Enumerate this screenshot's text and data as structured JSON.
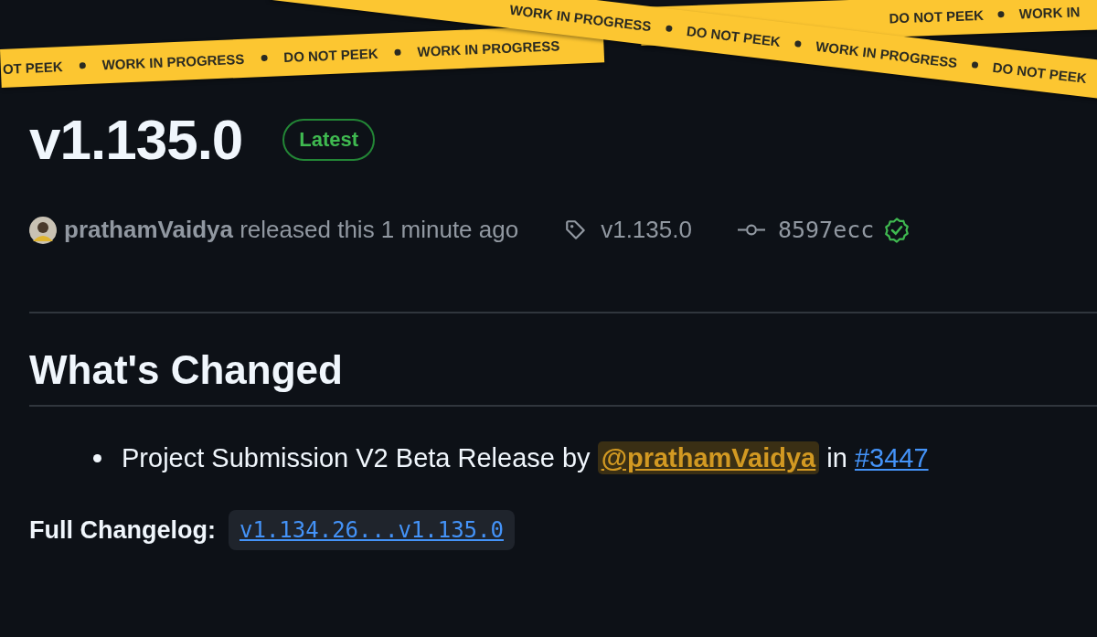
{
  "tapes": [
    {
      "texts": [
        "DO NOT PEEK",
        "WORK IN"
      ]
    },
    {
      "texts": [
        "OT PEEK",
        "WORK IN PROGRESS",
        "DO NOT PEEK",
        "WORK IN PROGRESS"
      ]
    },
    {
      "texts": [
        "WORK IN PROGRESS",
        "DO NOT PEEK",
        "WORK IN PROGRESS",
        "DO NOT PEEK"
      ]
    }
  ],
  "release": {
    "title": "v1.135.0",
    "badge": "Latest"
  },
  "meta": {
    "author": "prathamVaidya",
    "action": "released this 1 minute ago",
    "tag": "v1.135.0",
    "commit": "8597ecc",
    "verified": true
  },
  "section": {
    "heading": "What's Changed"
  },
  "changes": [
    {
      "text": "Project Submission V2 Beta Release by",
      "mention": "@prathamVaidya",
      "joiner": "in",
      "pr": "#3447"
    }
  ],
  "changelog": {
    "label": "Full Changelog:",
    "link": "v1.134.26...v1.135.0"
  }
}
